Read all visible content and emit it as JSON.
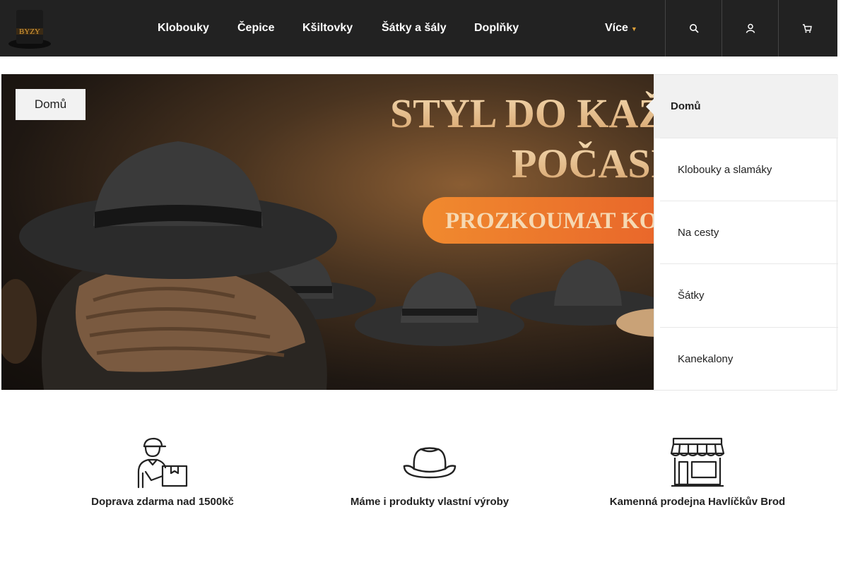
{
  "header": {
    "logo_text": "BYZY",
    "nav": [
      {
        "label": "Klobouky"
      },
      {
        "label": "Čepice"
      },
      {
        "label": "Kšiltovky"
      },
      {
        "label": "Šátky a šály"
      },
      {
        "label": "Doplňky"
      }
    ],
    "more_label": "Více",
    "icons": [
      "search-icon",
      "user-icon",
      "cart-icon"
    ]
  },
  "banner": {
    "headline_1": "STYL DO KAŽ",
    "headline_2": "POČASÍ",
    "cta": "PROZKOUMAT KO",
    "breadcrumb": "Domů"
  },
  "sidebar": {
    "title": "Domů",
    "items": [
      {
        "label": "Klobouky a slamáky"
      },
      {
        "label": "Na cesty"
      },
      {
        "label": "Šátky"
      },
      {
        "label": "Kanekalony"
      }
    ]
  },
  "features": [
    {
      "icon": "delivery-person-icon",
      "text": "Doprava zdarma nad 1500kč"
    },
    {
      "icon": "hat-icon",
      "text": "Máme i produkty vlastní výroby"
    },
    {
      "icon": "storefront-icon",
      "text": "Kamenná prodejna Havlíčkův Brod"
    }
  ],
  "colors": {
    "header_bg": "#222222",
    "accent": "#e0a23a",
    "cta": "#f07a2a"
  }
}
